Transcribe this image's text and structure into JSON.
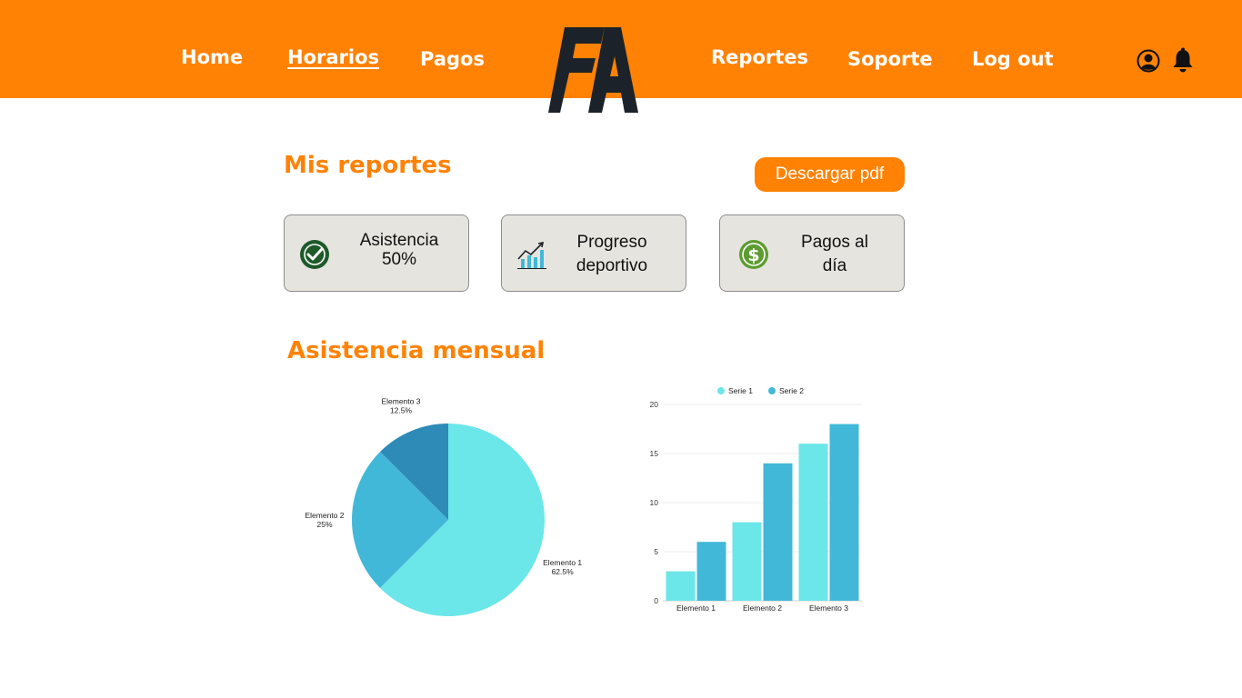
{
  "nav": {
    "items": [
      {
        "label": "Home"
      },
      {
        "label": "Horarios"
      },
      {
        "label": "Pagos"
      },
      {
        "label": "Reportes"
      },
      {
        "label": "Soporte"
      },
      {
        "label": "Log out"
      }
    ],
    "active": "Horarios"
  },
  "colors": {
    "brand_orange": "#ff8205",
    "logo_dark": "#1c2229",
    "card_bg": "#e6e4df",
    "check_green": "#1e5a2a",
    "dollar_green": "#5d9c2f",
    "series1": "#6be6e9",
    "series2": "#42b8d8",
    "slice3": "#2e8bb8"
  },
  "icons": {
    "user": "user-circle-icon",
    "bell": "bell-icon",
    "asistencia": "check-circle-icon",
    "progreso": "growth-chart-icon",
    "pagos": "dollar-circle-icon"
  },
  "reports": {
    "title": "Mis reportes",
    "download_label": "Descargar pdf",
    "cards": [
      {
        "line1": "Asistencia",
        "line2": "50%"
      },
      {
        "line1": "Progreso",
        "line2": "deportivo"
      },
      {
        "line1": "Pagos al",
        "line2": "día"
      }
    ]
  },
  "attendance": {
    "title": "Asistencia mensual"
  },
  "chart_data": [
    {
      "type": "pie",
      "labels": [
        "Elemento 1",
        "Elemento 2",
        "Elemento 3"
      ],
      "values": [
        62.5,
        25,
        12.5
      ],
      "value_labels": [
        "62.5%",
        "25%",
        "12.5%"
      ]
    },
    {
      "type": "bar",
      "categories": [
        "Elemento 1",
        "Elemento 2",
        "Elemento 3"
      ],
      "series": [
        {
          "name": "Serie 1",
          "values": [
            3,
            8,
            16
          ]
        },
        {
          "name": "Serie 2",
          "values": [
            6,
            14,
            18
          ]
        }
      ],
      "ylim": [
        0,
        20
      ],
      "yticks": [
        0,
        5,
        10,
        15,
        20
      ],
      "grid": true,
      "legend": "top"
    }
  ]
}
